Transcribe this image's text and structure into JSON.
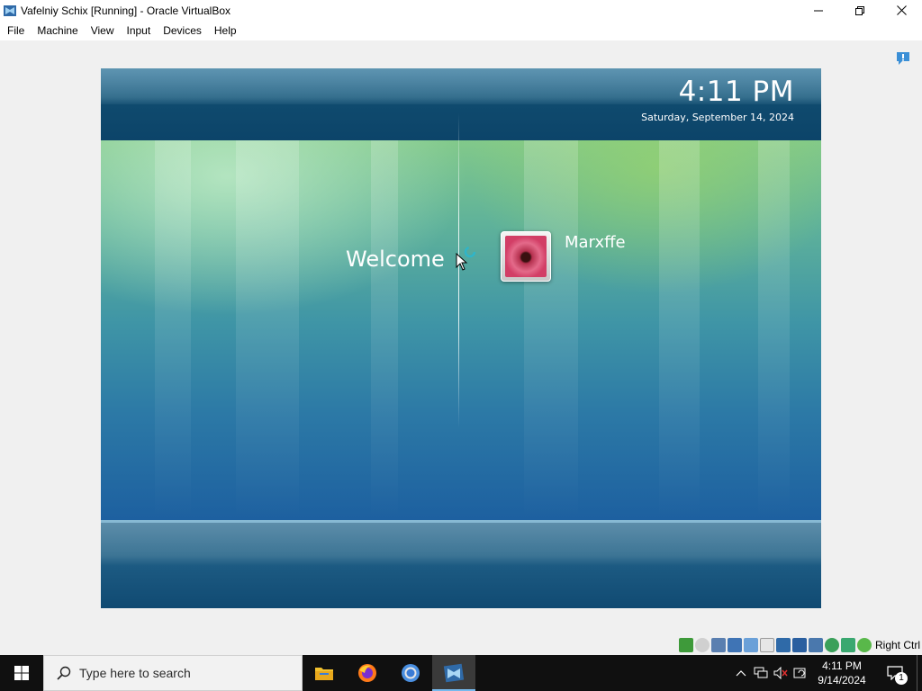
{
  "window": {
    "title": "Vafelniy  Schix [Running] - Oracle VirtualBox",
    "icon": "virtualbox-icon"
  },
  "menubar": {
    "items": [
      "File",
      "Machine",
      "View",
      "Input",
      "Devices",
      "Help"
    ]
  },
  "guest": {
    "time": "4:11 PM",
    "date": "Saturday, September 14, 2024",
    "welcome": "Welcome",
    "user_name": "Marxffe",
    "colors": {
      "top_band": "#0f4a6e",
      "main_top": "#82c98a",
      "main_bottom": "#1d60a0"
    }
  },
  "statusbar": {
    "host_key_label": "Right Ctrl",
    "icons": [
      "hard-disk-icon",
      "optical-drive-icon",
      "audio-icon",
      "network-icon",
      "usb-icon",
      "shared-folders-icon",
      "display-icon",
      "video-capture-icon",
      "recording-icon",
      "guest-additions-icon",
      "cpu-icon",
      "mouse-integration-icon"
    ]
  },
  "taskbar": {
    "search_placeholder": "Type here to search",
    "apps": [
      "file-explorer-icon",
      "firefox-icon",
      "chrome-icon",
      "virtualbox-icon"
    ],
    "active_app": "virtualbox-icon",
    "clock_time": "4:11 PM",
    "clock_date": "9/14/2024",
    "notification_count": "1"
  }
}
